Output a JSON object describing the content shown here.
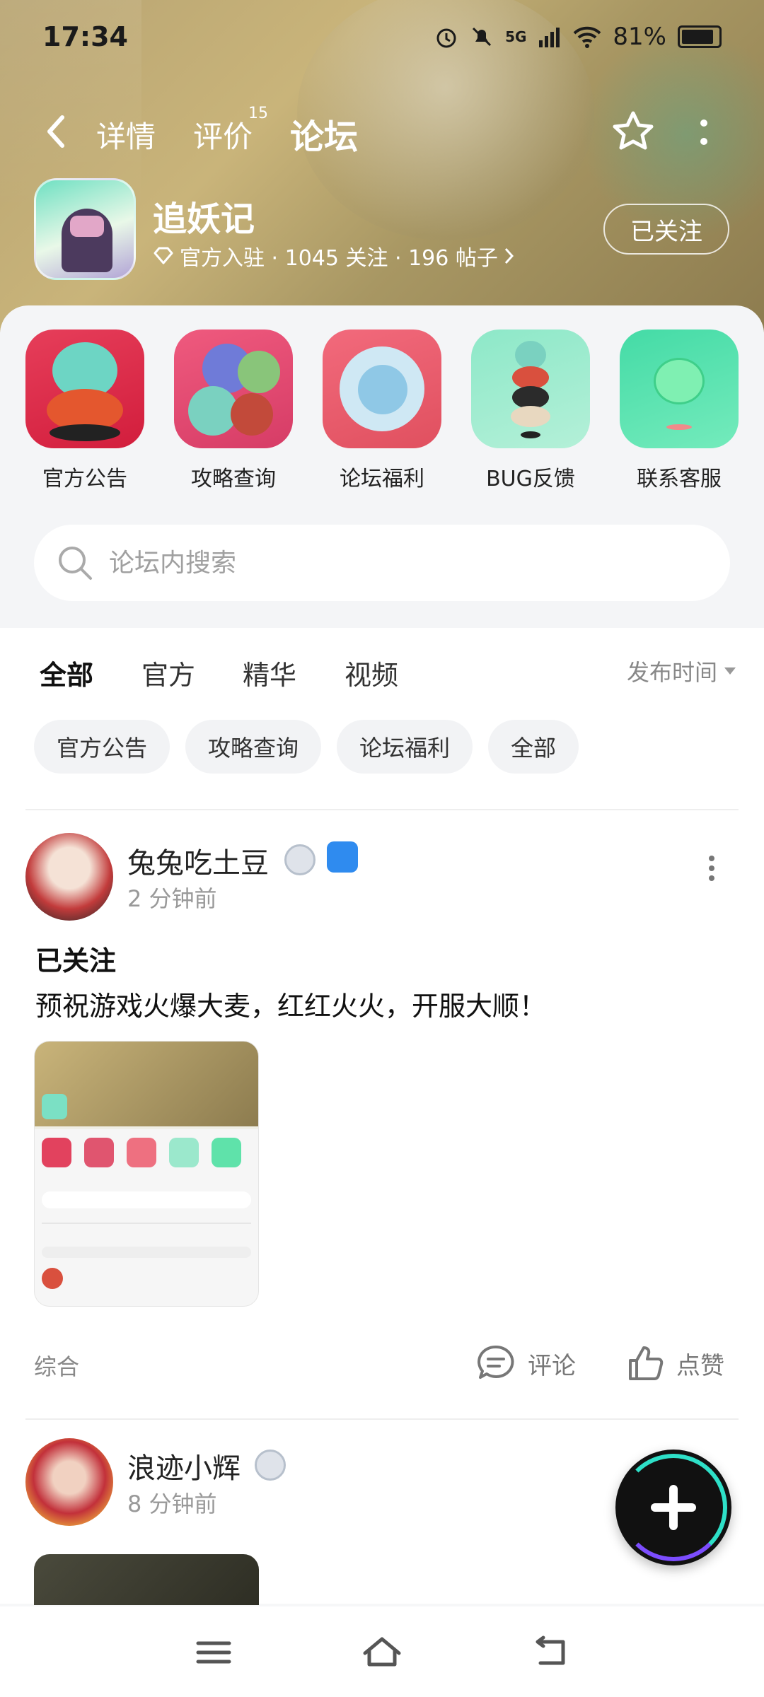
{
  "status_bar": {
    "time": "17:34",
    "network": "5G",
    "battery": "81%"
  },
  "nav": {
    "tabs": [
      {
        "label": "详情"
      },
      {
        "label": "评价",
        "count": "15"
      },
      {
        "label": "论坛"
      }
    ],
    "active_tab": "论坛"
  },
  "game": {
    "name": "追妖记",
    "meta": "官方入驻 · 1045 关注 · 196 帖子",
    "follow_label": "已关注"
  },
  "quick_links": [
    {
      "label": "官方公告"
    },
    {
      "label": "攻略查询"
    },
    {
      "label": "论坛福利"
    },
    {
      "label": "BUG反馈"
    },
    {
      "label": "联系客服"
    }
  ],
  "search": {
    "placeholder": "论坛内搜索"
  },
  "feed_tabs": [
    {
      "label": "全部"
    },
    {
      "label": "官方"
    },
    {
      "label": "精华"
    },
    {
      "label": "视频"
    }
  ],
  "sort_label": "发布时间",
  "chips": [
    {
      "label": "官方公告"
    },
    {
      "label": "攻略查询"
    },
    {
      "label": "论坛福利"
    },
    {
      "label": "全部"
    }
  ],
  "posts": [
    {
      "user": "兔兔吃土豆",
      "time": "2 分钟前",
      "title": "已关注",
      "body": "预祝游戏火爆大麦，红红火火，开服大顺！",
      "category": "综合",
      "comment_label": "评论",
      "like_label": "点赞"
    },
    {
      "user": "浪迹小辉",
      "time": "8 分钟前"
    }
  ],
  "colors": {
    "accent": "#2ee0c8",
    "banner": "#b8a472"
  }
}
